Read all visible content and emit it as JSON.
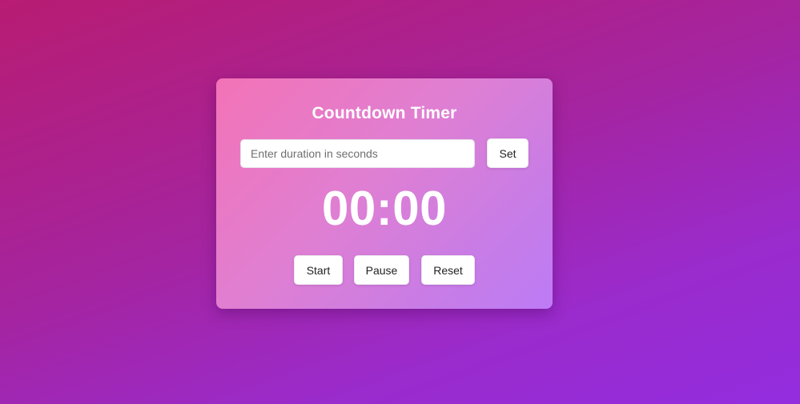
{
  "timer": {
    "title": "Countdown Timer",
    "duration_input": {
      "value": "",
      "placeholder": "Enter duration in seconds"
    },
    "set_label": "Set",
    "display": "00:00",
    "controls": {
      "start_label": "Start",
      "pause_label": "Pause",
      "reset_label": "Reset"
    }
  },
  "colors": {
    "background_start": "#b81c72",
    "background_end": "#932ddf",
    "card_start": "#f373b6",
    "card_end": "#bd7bf6",
    "text_on_card": "#ffffff",
    "button_bg": "#ffffff"
  }
}
